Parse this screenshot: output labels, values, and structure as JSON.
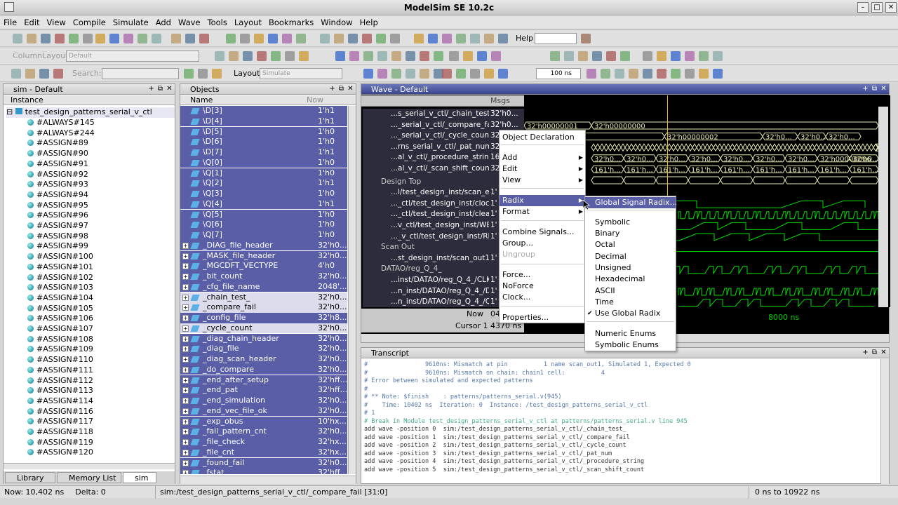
{
  "window": {
    "title": "ModelSim SE 10.2c"
  },
  "menu": [
    "File",
    "Edit",
    "View",
    "Compile",
    "Simulate",
    "Add",
    "Wave",
    "Tools",
    "Layout",
    "Bookmarks",
    "Window",
    "Help"
  ],
  "toolbar": {
    "help_label": "Help",
    "column_layout_label": "ColumnLayout",
    "column_layout_value": "Default",
    "search_label": "Search:",
    "layout_label": "Layout",
    "layout_value": "Simulate",
    "run_length": "100 ns"
  },
  "sim_pane": {
    "title": "sim - Default",
    "column": "Instance",
    "root": "test_design_patterns_serial_v_ctl",
    "items": [
      "#ALWAYS#145",
      "#ALWAYS#244",
      "#ASSIGN#89",
      "#ASSIGN#90",
      "#ASSIGN#91",
      "#ASSIGN#92",
      "#ASSIGN#93",
      "#ASSIGN#94",
      "#ASSIGN#95",
      "#ASSIGN#96",
      "#ASSIGN#97",
      "#ASSIGN#98",
      "#ASSIGN#99",
      "#ASSIGN#100",
      "#ASSIGN#101",
      "#ASSIGN#102",
      "#ASSIGN#103",
      "#ASSIGN#104",
      "#ASSIGN#105",
      "#ASSIGN#106",
      "#ASSIGN#107",
      "#ASSIGN#108",
      "#ASSIGN#109",
      "#ASSIGN#110",
      "#ASSIGN#111",
      "#ASSIGN#112",
      "#ASSIGN#113",
      "#ASSIGN#114",
      "#ASSIGN#116",
      "#ASSIGN#117",
      "#ASSIGN#118",
      "#ASSIGN#119",
      "#ASSIGN#120"
    ],
    "tabs": [
      "Library",
      "Memory List",
      "sim"
    ]
  },
  "objects_pane": {
    "title": "Objects",
    "col_name": "Name",
    "col_now": "Now",
    "rows": [
      {
        "n": "\\D[3]",
        "v": "1'h1"
      },
      {
        "n": "\\D[4]",
        "v": "1'h1"
      },
      {
        "n": "\\D[5]",
        "v": "1'h0"
      },
      {
        "n": "\\D[6]",
        "v": "1'h0"
      },
      {
        "n": "\\D[7]",
        "v": "1'h1"
      },
      {
        "n": "\\Q[0]",
        "v": "1'h0"
      },
      {
        "n": "\\Q[1]",
        "v": "1'h0"
      },
      {
        "n": "\\Q[2]",
        "v": "1'h1"
      },
      {
        "n": "\\Q[3]",
        "v": "1'h0"
      },
      {
        "n": "\\Q[4]",
        "v": "1'h1"
      },
      {
        "n": "\\Q[5]",
        "v": "1'h0"
      },
      {
        "n": "\\Q[6]",
        "v": "1'h0"
      },
      {
        "n": "\\Q[7]",
        "v": "1'h0"
      },
      {
        "n": "_DIAG_file_header",
        "v": "32'h0..."
      },
      {
        "n": "_MASK_file_header",
        "v": "32'h0..."
      },
      {
        "n": "_MGCDFT_VECTYPE",
        "v": "4'h0"
      },
      {
        "n": "_bit_count",
        "v": "32'h0..."
      },
      {
        "n": "_cfg_file_name",
        "v": "2048'..."
      },
      {
        "n": "_chain_test_",
        "v": "32'h0..."
      },
      {
        "n": "_compare_fail",
        "v": "32'h0..."
      },
      {
        "n": "_config_file",
        "v": "32'h8..."
      },
      {
        "n": "_cycle_count",
        "v": "32'h0..."
      },
      {
        "n": "_diag_chain_header",
        "v": "32'h0..."
      },
      {
        "n": "_diag_file",
        "v": "32'h0..."
      },
      {
        "n": "_diag_scan_header",
        "v": "32'h0..."
      },
      {
        "n": "_do_compare",
        "v": "32'h0..."
      },
      {
        "n": "_end_after_setup",
        "v": "32'hff..."
      },
      {
        "n": "_end_pat",
        "v": "32'hff..."
      },
      {
        "n": "_end_simulation",
        "v": "32'h0..."
      },
      {
        "n": "_end_vec_file_ok",
        "v": "32'h0..."
      },
      {
        "n": "_exp_obus",
        "v": "10'hx..."
      },
      {
        "n": "_fail_pattern_cnt",
        "v": "32'h0..."
      },
      {
        "n": "_file_check",
        "v": "32'hx..."
      },
      {
        "n": "_file_cnt",
        "v": "32'hx..."
      },
      {
        "n": "_found_fail",
        "v": "32'h0..."
      },
      {
        "n": "_fstat",
        "v": "32'hff..."
      }
    ]
  },
  "wave_pane": {
    "title": "Wave - Default",
    "msgs": "Msgs",
    "signals": [
      {
        "n": "...s_serial_v_ctl/_chain_test_",
        "v": "32'h0..."
      },
      {
        "n": "..._serial_v_ctl/_compare_fail",
        "v": "32'h0..."
      },
      {
        "n": "..._serial_v_ctl/_cycle_count",
        "v": "32"
      },
      {
        "n": "...rns_serial_v_ctl/_pat_num",
        "v": "32"
      },
      {
        "n": "...al_v_ctl/_procedure_string",
        "v": "16"
      },
      {
        "n": "...al_v_ctl/_scan_shift_count",
        "v": "32"
      },
      {
        "n": "Design Top",
        "v": ""
      },
      {
        "n": "...l/test_design_inst/scan_en",
        "v": "1'"
      },
      {
        "n": "..._ctl/test_design_inst/clock",
        "v": "1'"
      },
      {
        "n": "..._ctl/test_design_inst/clear",
        "v": "1'"
      },
      {
        "n": "...v_ctl/test_design_inst/WE",
        "v": "1'"
      },
      {
        "n": "..._v_ctl/test_design_inst/RE",
        "v": "1'"
      },
      {
        "n": "Scan Out",
        "v": ""
      },
      {
        "n": "...st_design_inst/scan_out1",
        "v": "1'"
      },
      {
        "n": "DATAO/reg_Q_4_",
        "v": ""
      },
      {
        "n": "...inst/DATAO/reg_Q_4_/CLK",
        "v": "1'"
      },
      {
        "n": "...n_inst/DATAO/reg_Q_4_/D",
        "v": "1'"
      },
      {
        "n": "...n_inst/DATAO/reg_Q_4_/Q",
        "v": "1'"
      }
    ],
    "now_label": "Now",
    "now_value": "04",
    "cursor_label": "Cursor 1",
    "cursor_value": "4370 ns",
    "time_label": "8000 ns",
    "bus_values": [
      "32'h00000001",
      "32'h00000000",
      "32'h00000002",
      "32'h0...",
      "32'h0...",
      "32'h0...",
      "32'h00000006",
      "161'h...",
      "32'h0..."
    ]
  },
  "context_menu": {
    "items": [
      "Object Declaration",
      "Add",
      "Edit",
      "View",
      "Radix",
      "Format",
      "Combine Signals...",
      "Group...",
      "Ungroup",
      "Force...",
      "NoForce",
      "Clock...",
      "Properties..."
    ]
  },
  "radix_menu": {
    "items": [
      "Global Signal Radix...",
      "Symbolic",
      "Binary",
      "Octal",
      "Decimal",
      "Unsigned",
      "Hexadecimal",
      "ASCII",
      "Time",
      "Use Global Radix",
      "Numeric Enums",
      "Symbolic Enums"
    ],
    "checked": "Use Global Radix"
  },
  "transcript": {
    "title": "Transcript",
    "lines": [
      "#                9610ns: Mismatch at pin          1 name scan_out1, Simulated 1, Expected 0",
      "#                9610ns: Mismatch on chain: chain1 cell:          4",
      "# Error between simulated and expected patterns",
      "#",
      "# ** Note: $finish    : patterns/patterns_serial.v(945)",
      "#    Time: 10402 ns  Iteration: 0  Instance: /test_design_patterns_serial_v_ctl",
      "# 1",
      "# Break in Module test_design_patterns_serial_v_ctl at patterns/patterns_serial.v line 945",
      "add wave -position 0  sim:/test_design_patterns_serial_v_ctl/_chain_test_",
      "add wave -position 1  sim:/test_design_patterns_serial_v_ctl/_compare_fail",
      "add wave -position 2  sim:/test_design_patterns_serial_v_ctl/_cycle_count",
      "add wave -position 3  sim:/test_design_patterns_serial_v_ctl/_pat_num",
      "add wave -position 4  sim:/test_design_patterns_serial_v_ctl/_procedure_string",
      "add wave -position 5  sim:/test_design_patterns_serial_v_ctl/_scan_shift_count"
    ]
  },
  "status": {
    "now": "Now: 10,402 ns",
    "delta": "Delta: 0",
    "path": "sim:/test_design_patterns_serial_v_ctl/_compare_fail [31:0]",
    "range": "0 ns to 10922 ns"
  },
  "colors": {
    "selection": "#5a5ea6",
    "wave_green": "#00e000",
    "bus_yellow": "#e8e8b0",
    "cursor": "#e8c000"
  }
}
